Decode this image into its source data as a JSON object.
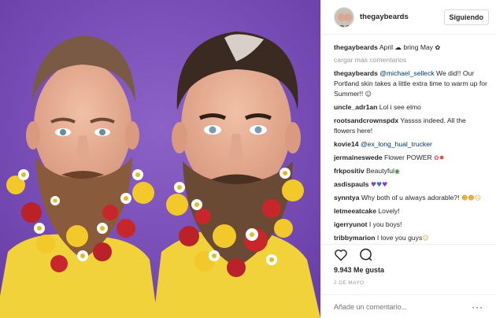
{
  "post": {
    "username": "thegaybeards",
    "follow_label": "Siguiendo",
    "caption": {
      "user": "thegaybeards",
      "text": "April ☁ bring May "
    },
    "load_more_label": "cargar más comentarios",
    "comments": [
      {
        "user": "thegaybeards",
        "mention": "@michael_selleck",
        "text": " We did!! Our Portland skin takes a little extra time to warm up for Summer!! "
      },
      {
        "user": "uncle_adr1an",
        "mention": "",
        "text": "Lol i see elmo"
      },
      {
        "user": "rootsandcrownspdx",
        "mention": "",
        "text": "Yassss indeed. All the flowers here!"
      },
      {
        "user": "kovie14",
        "mention": "@ex_long_hual_trucker",
        "text": ""
      },
      {
        "user": "jermaineswede",
        "mention": "",
        "text": "Flower  POWER "
      },
      {
        "user": "frkpositiv",
        "mention": "",
        "text": "Beautyful"
      },
      {
        "user": "asdispauls",
        "mention": "",
        "text": ""
      },
      {
        "user": "synntya",
        "mention": "",
        "text": "Why both of u always adorable?!"
      },
      {
        "user": "letmeeatcake",
        "mention": "",
        "text": "Lovely!"
      },
      {
        "user": "igerryunot",
        "mention": "",
        "text": "I  you boys!"
      },
      {
        "user": "tribbymarion",
        "mention": "",
        "text": "I love you guys"
      }
    ],
    "likes": "9.943 Me gusta",
    "date": "2 DE MAYO",
    "add_comment_placeholder": "Añade un comentario...",
    "more_options": "···"
  },
  "icons": [
    "heart-icon",
    "comment-icon",
    "more-options-icon"
  ],
  "colors": {
    "background_purple": "#7a4fb8",
    "shirt_yellow": "#f2d23a",
    "mention_blue": "#003569"
  }
}
